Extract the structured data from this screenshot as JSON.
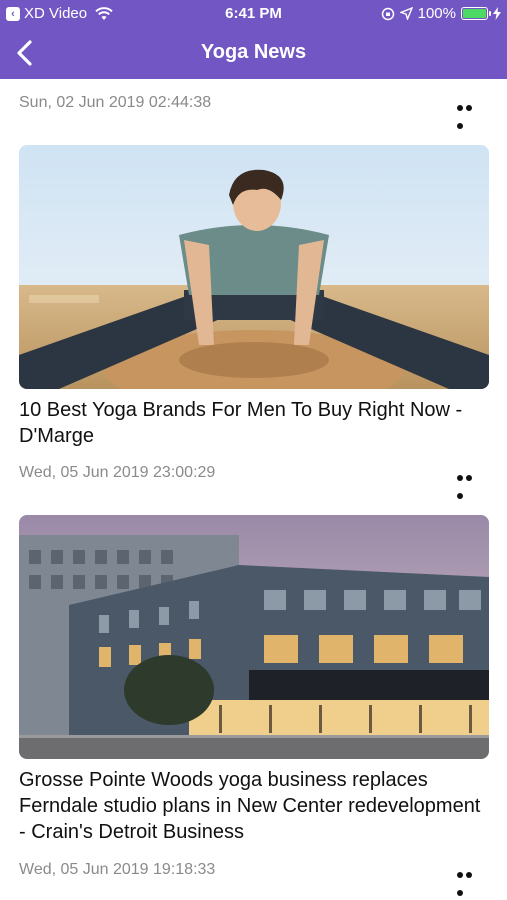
{
  "status_bar": {
    "carrier": "XD Video",
    "time": "6:41 PM",
    "battery": "100%",
    "battery_level": 1.0
  },
  "nav": {
    "title": "Yoga News",
    "back_icon": "chevron-left-icon"
  },
  "feed": {
    "top_date": "Sun, 02 Jun 2019 02:44:38",
    "articles": [
      {
        "title": "10 Best Yoga Brands For Men To Buy Right Now - D'Marge",
        "date": "Wed, 05 Jun 2019 23:00:29",
        "image": "man-yoga-pose-photo"
      },
      {
        "title": "Grosse Pointe Woods yoga business replaces Ferndale studio plans in New Center redevelopment - Crain's Detroit Business",
        "date": "Wed, 05 Jun 2019 19:18:33",
        "image": "city-building-photo"
      }
    ]
  },
  "colors": {
    "header": "#7257c4",
    "date_text": "#8a8a8a",
    "title_text": "#111111"
  }
}
